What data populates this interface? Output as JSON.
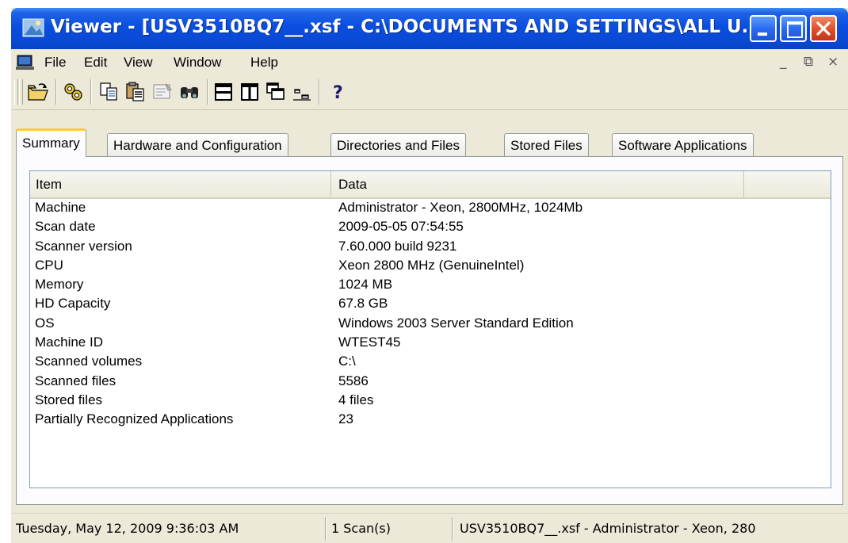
{
  "window": {
    "title": "Viewer - [USV3510BQ7__.xsf - C:\\DOCUMENTS AND SETTINGS\\ALL U...",
    "controls": {
      "minimize": "minimize-icon",
      "maximize": "maximize-icon",
      "close": "close-icon"
    }
  },
  "menubar": {
    "items": [
      "File",
      "Edit",
      "View",
      "Window",
      "Help"
    ],
    "mdi_controls": {
      "minimize": "_",
      "restore": "⧉",
      "close": "×"
    }
  },
  "toolbar": {
    "icons": [
      "open-folder-icon",
      "scan-icon",
      "copy-icon",
      "paste-icon",
      "properties-icon",
      "find-icon",
      "split-horizontal-icon",
      "split-vertical-icon",
      "cascade-icon",
      "arrange-icon",
      "help-icon"
    ]
  },
  "tabs": [
    {
      "label": "Summary",
      "active": true
    },
    {
      "label": "Hardware and Configuration",
      "active": false
    },
    {
      "label": "Directories and Files",
      "active": false
    },
    {
      "label": "Stored Files",
      "active": false
    },
    {
      "label": "Software Applications",
      "active": false
    }
  ],
  "list": {
    "columns": [
      "Item",
      "Data"
    ],
    "rows": [
      {
        "item": "Machine",
        "data": "Administrator - Xeon, 2800MHz, 1024Mb"
      },
      {
        "item": "Scan date",
        "data": "2009-05-05 07:54:55"
      },
      {
        "item": "Scanner version",
        "data": "7.60.000 build 9231"
      },
      {
        "item": "CPU",
        "data": "Xeon 2800 MHz (GenuineIntel)"
      },
      {
        "item": "Memory",
        "data": "1024 MB"
      },
      {
        "item": "HD Capacity",
        "data": "67.8 GB"
      },
      {
        "item": "OS",
        "data": "Windows 2003 Server Standard Edition"
      },
      {
        "item": "Machine ID",
        "data": "WTEST45"
      },
      {
        "item": "Scanned volumes",
        "data": "C:\\"
      },
      {
        "item": "Scanned files",
        "data": "5586"
      },
      {
        "item": "Stored files",
        "data": "4 files"
      },
      {
        "item": "Partially Recognized Applications",
        "data": "23"
      }
    ]
  },
  "statusbar": {
    "date": "Tuesday, May 12, 2009 9:36:03 AM",
    "scans": "1 Scan(s)",
    "file": "USV3510BQ7__.xsf - Administrator - Xeon, 280"
  },
  "colors": {
    "title_bar": "#0a4ee0",
    "close_button": "#e0512a",
    "active_tab_accent": "#ffc83d",
    "chrome": "#ece9d8"
  }
}
